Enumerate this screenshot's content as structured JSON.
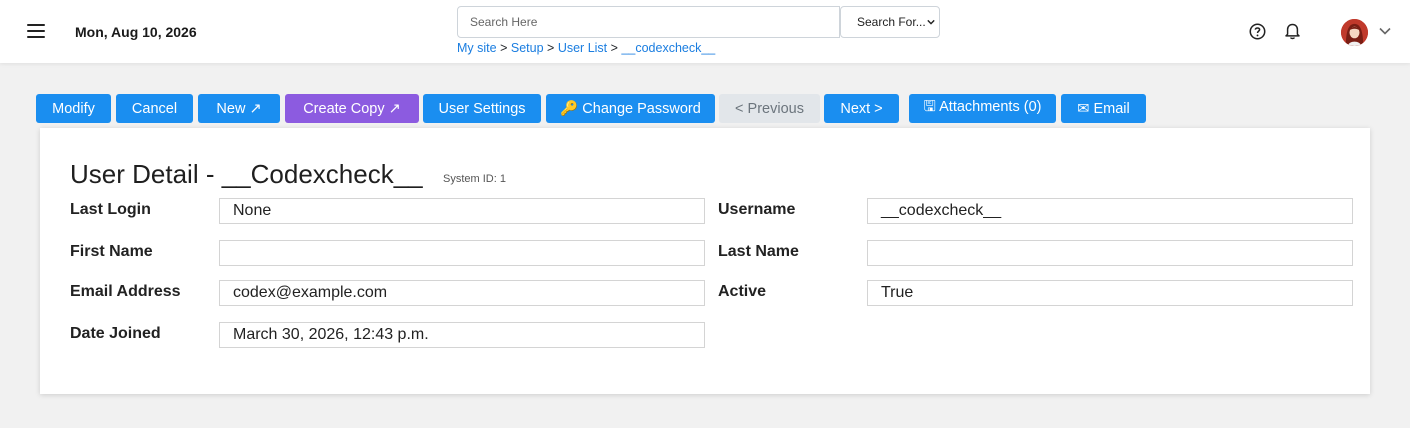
{
  "header": {
    "date": "Mon, Aug 10, 2026",
    "search": {
      "placeholder": "Search Here",
      "select_value": "Search For..."
    },
    "breadcrumb": [
      {
        "label": "My site"
      },
      {
        "label": "Setup"
      },
      {
        "label": "User List"
      },
      {
        "label": "__codexcheck__"
      }
    ],
    "breadcrumb_separator": ">"
  },
  "toolbar": {
    "modify": "Modify",
    "cancel": "Cancel",
    "new": "New ↗",
    "create_copy": "Create Copy ↗",
    "user_settings": "User Settings",
    "change_password": "🔑 Change Password",
    "previous": "< Previous",
    "next": "Next >",
    "attachments": "🖫 Attachments (0)",
    "email": "✉ Email"
  },
  "detail": {
    "title": "User Detail - __Codexcheck__",
    "system_id": "System ID: 1",
    "fields": {
      "last_login": {
        "label": "Last Login",
        "value": "None"
      },
      "username": {
        "label": "Username",
        "value": "__codexcheck__"
      },
      "first_name": {
        "label": "First Name",
        "value": ""
      },
      "last_name": {
        "label": "Last Name",
        "value": ""
      },
      "email": {
        "label": "Email Address",
        "value": "codex@example.com"
      },
      "active": {
        "label": "Active",
        "value": "True"
      },
      "date_joined": {
        "label": "Date Joined",
        "value": "March 30, 2026, 12:43 p.m."
      }
    }
  },
  "colors": {
    "primary_button": "#1a8ef0",
    "purple_button": "#8c5be0",
    "disabled_button": "#e2e6ea",
    "link": "#1a7de0",
    "page_background": "#f1f1f1"
  },
  "icons": [
    "hamburger-menu-icon",
    "help-circle-icon",
    "bell-icon",
    "user-avatar",
    "chevron-down-icon"
  ]
}
